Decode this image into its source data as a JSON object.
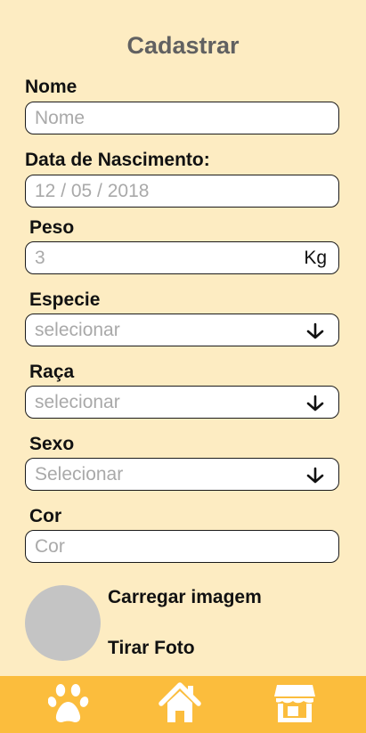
{
  "page": {
    "title": "Cadastrar"
  },
  "form": {
    "nome": {
      "label": "Nome",
      "placeholder": "Nome"
    },
    "nascimento": {
      "label": "Data de Nascimento:",
      "placeholder": "12 / 05 / 2018"
    },
    "peso": {
      "label": "Peso",
      "placeholder": "3",
      "unit": "Kg"
    },
    "especie": {
      "label": "Especie",
      "selected": "selecionar",
      "icon": "arrow-down-icon"
    },
    "raca": {
      "label": "Raça",
      "selected": "selecionar",
      "icon": "arrow-down-icon"
    },
    "sexo": {
      "label": "Sexo",
      "selected": "Selecionar",
      "icon": "arrow-down-icon"
    },
    "cor": {
      "label": "Cor",
      "placeholder": "Cor"
    }
  },
  "image_section": {
    "upload_label": "Carregar imagem",
    "camera_label": "Tirar Foto"
  },
  "navbar": {
    "background": "#fbbd3d",
    "items": [
      {
        "icon": "paw-icon"
      },
      {
        "icon": "home-icon"
      },
      {
        "icon": "store-icon"
      }
    ]
  },
  "colors": {
    "background": "#fdecc2",
    "title": "#616161",
    "placeholder": "#a9a9a9",
    "avatar": "#c4c4c4"
  }
}
